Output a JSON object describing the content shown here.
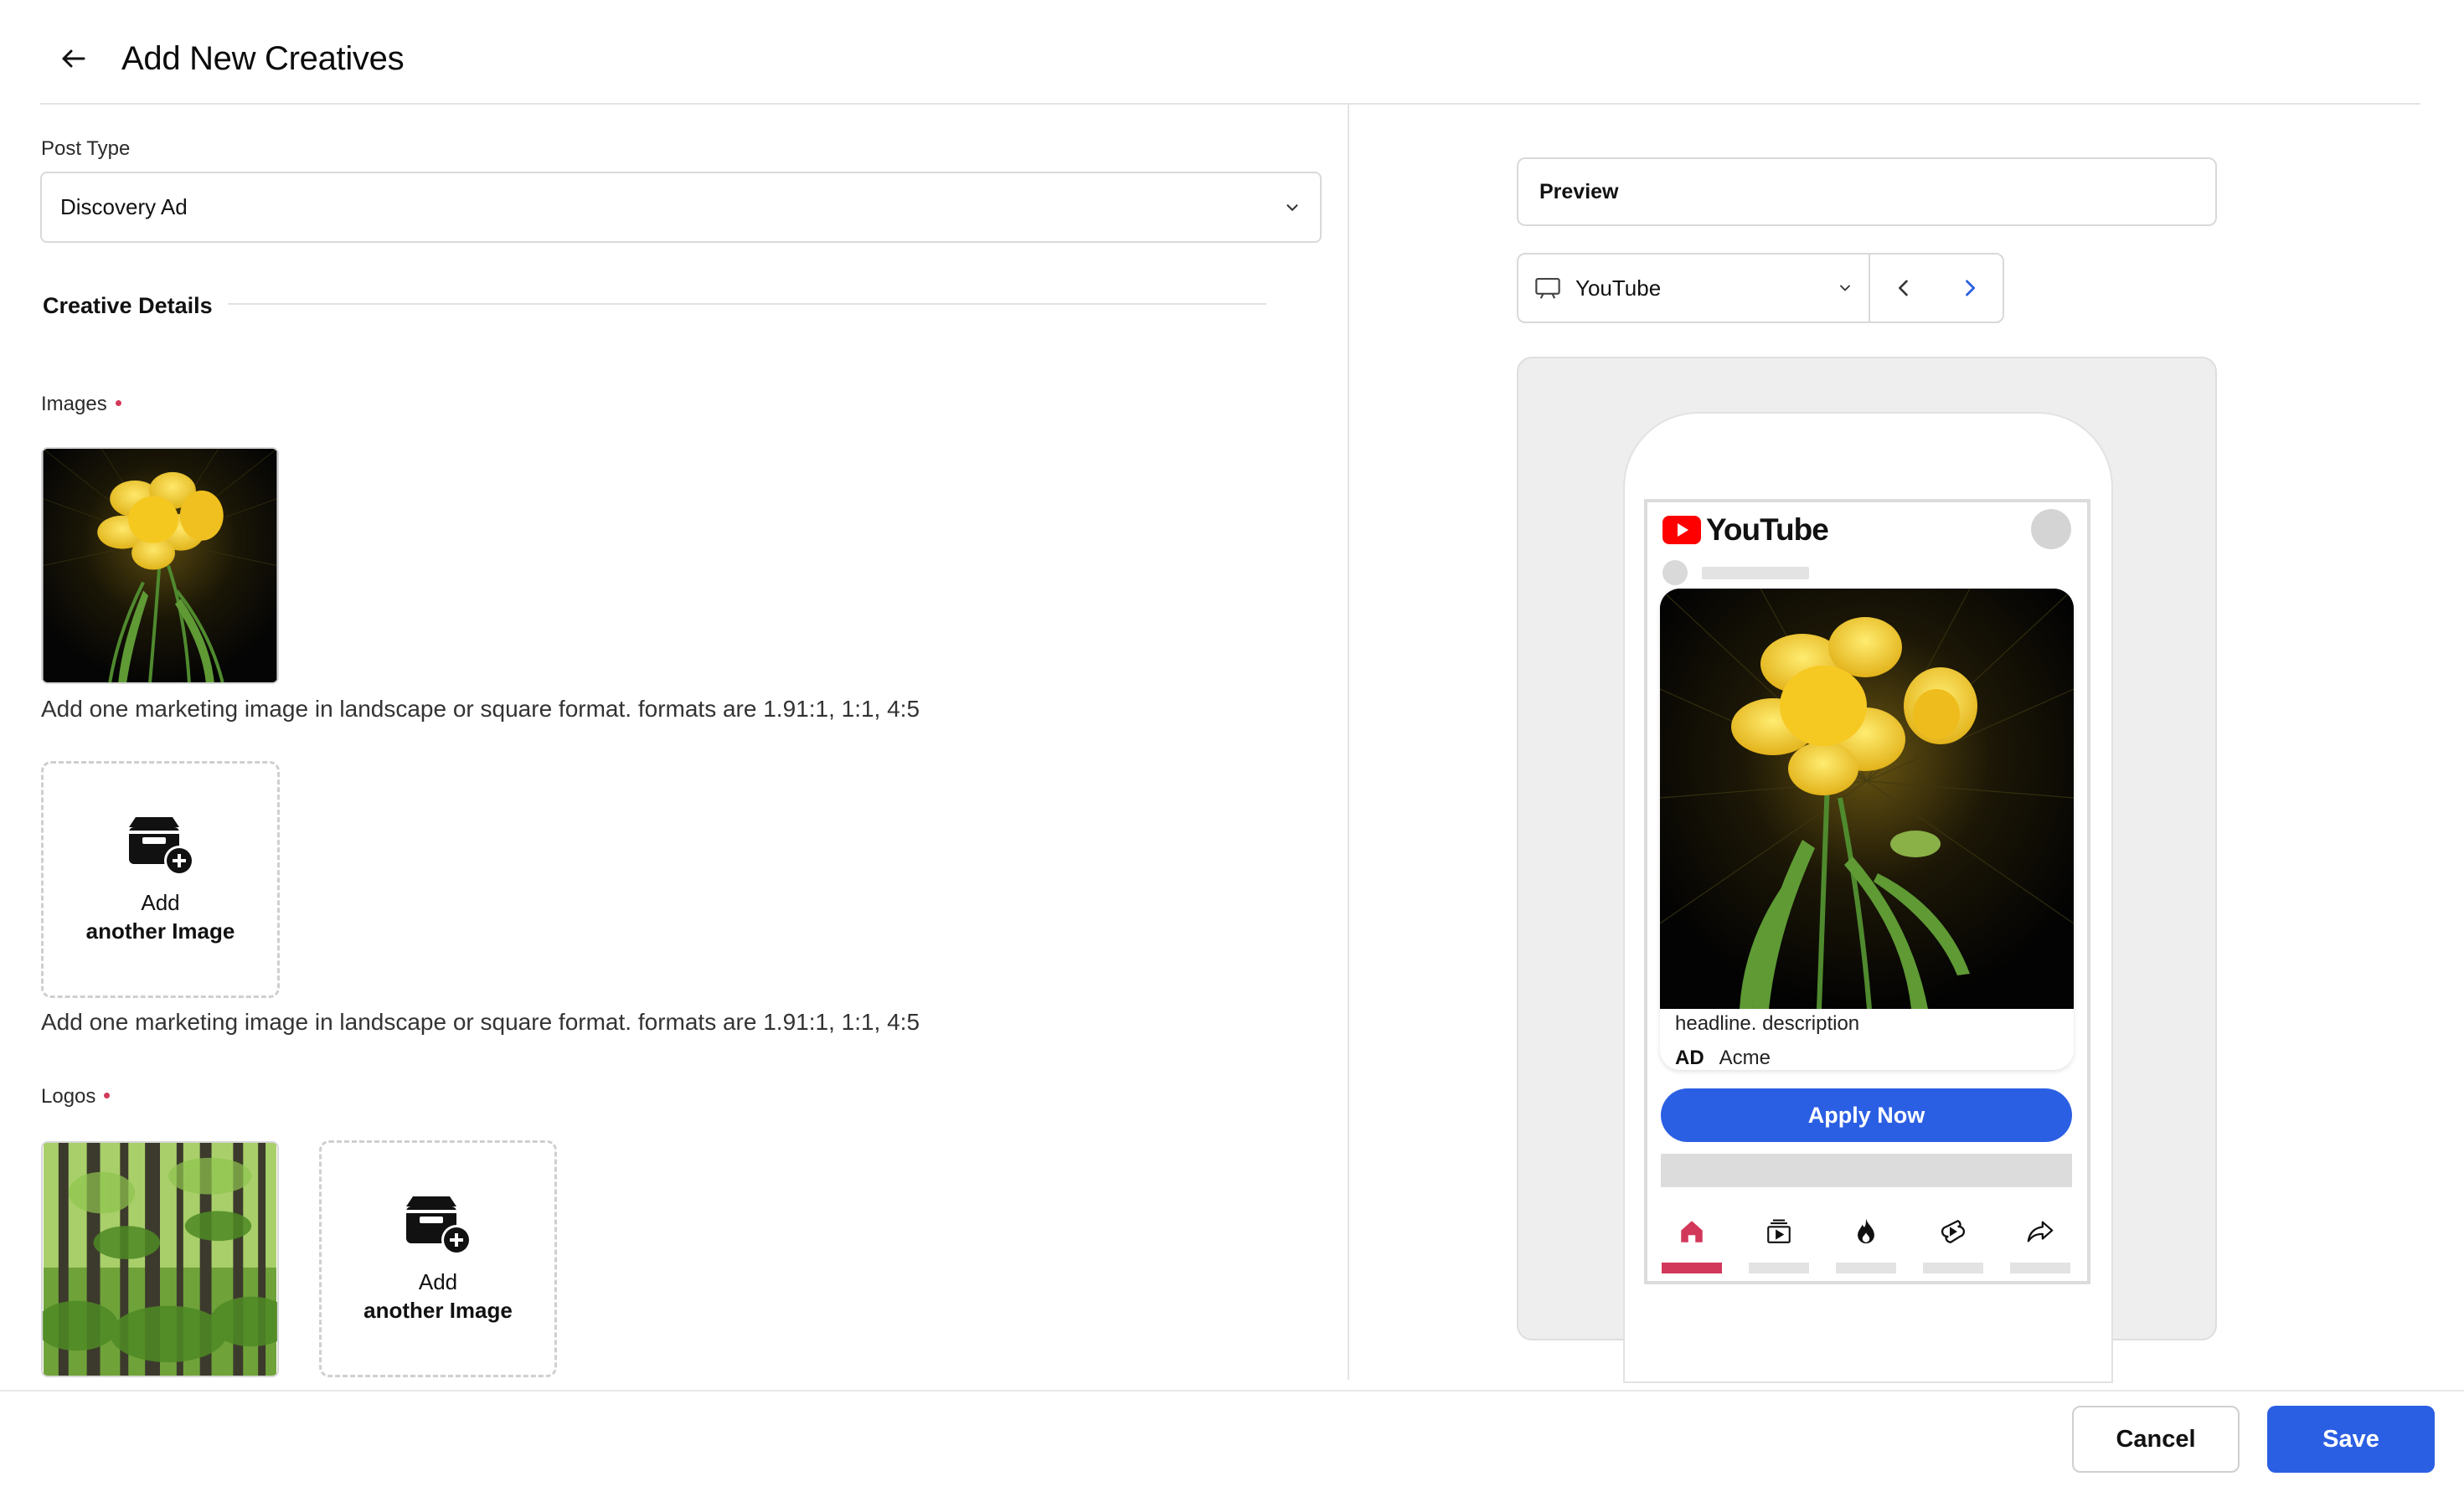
{
  "header": {
    "title": "Add New Creatives"
  },
  "form": {
    "post_type_label": "Post Type",
    "post_type_value": "Discovery Ad",
    "creative_details_title": "Creative Details",
    "images_label": "Images",
    "images_helper_1": "Add one marketing image in landscape or square format. formats are 1.91:1, 1:1, 4:5",
    "images_helper_2": "Add one marketing image in landscape or square format. formats are 1.91:1, 1:1, 4:5",
    "add_image_line1": "Add",
    "add_image_line2": "another Image",
    "logos_label": "Logos",
    "add_logo_line1": "Add",
    "add_logo_line2": "another Image"
  },
  "preview": {
    "title": "Preview",
    "platform_value": "YouTube",
    "yt_wordmark": "YouTube",
    "ad": {
      "headline": "headline. description",
      "badge": "AD",
      "brand": "Acme",
      "cta": "Apply Now"
    },
    "tabbar": [
      {
        "icon": "home-icon",
        "active": true
      },
      {
        "icon": "subscriptions-icon",
        "active": false
      },
      {
        "icon": "trending-icon",
        "active": false
      },
      {
        "icon": "shorts-icon",
        "active": false
      },
      {
        "icon": "share-icon",
        "active": false
      }
    ]
  },
  "footer": {
    "cancel_label": "Cancel",
    "save_label": "Save"
  },
  "colors": {
    "primary": "#2b5fe3",
    "required_dot": "#d23a5a",
    "yt_red": "#ff0000",
    "active_tab": "#d2385a"
  }
}
